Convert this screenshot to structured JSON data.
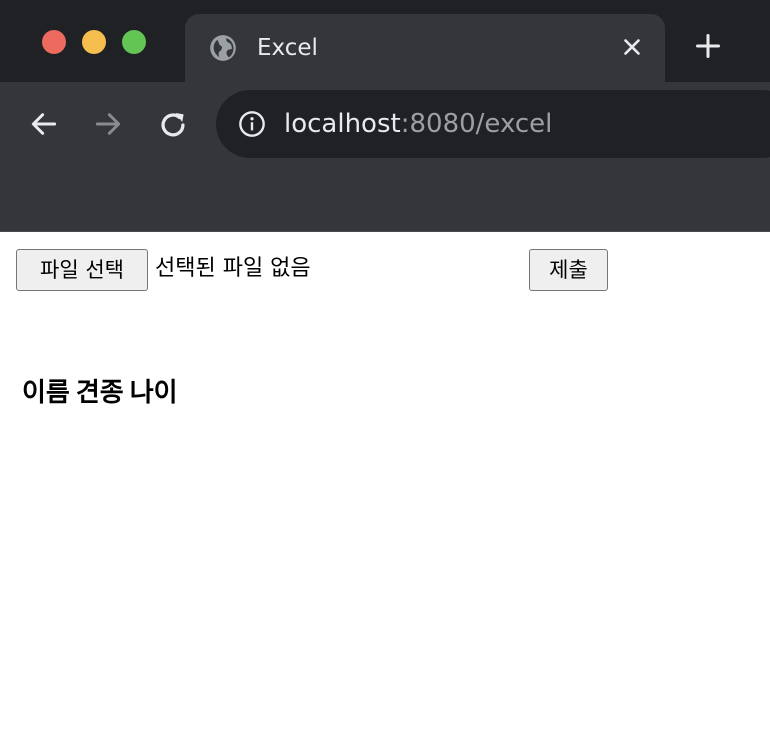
{
  "browser": {
    "tab": {
      "title": "Excel",
      "favicon": "globe-icon",
      "close": "close-icon"
    },
    "new_tab": "plus-icon",
    "nav": {
      "back": "arrow-left-icon",
      "forward": "arrow-right-icon",
      "reload": "reload-icon"
    },
    "address": {
      "info": "info-icon",
      "host": "localhost",
      "rest": ":8080/excel"
    },
    "colors": {
      "tabstrip": "#202124",
      "toolbar": "#35363a",
      "close": "#ed6a5e",
      "minimize": "#f5be4f",
      "zoom": "#62c554"
    }
  },
  "page": {
    "form": {
      "file_button_label": "파일 선택",
      "file_status": "선택된 파일 없음",
      "submit_label": "제출"
    },
    "table": {
      "headers": [
        "이름",
        "견종",
        "나이"
      ]
    }
  }
}
